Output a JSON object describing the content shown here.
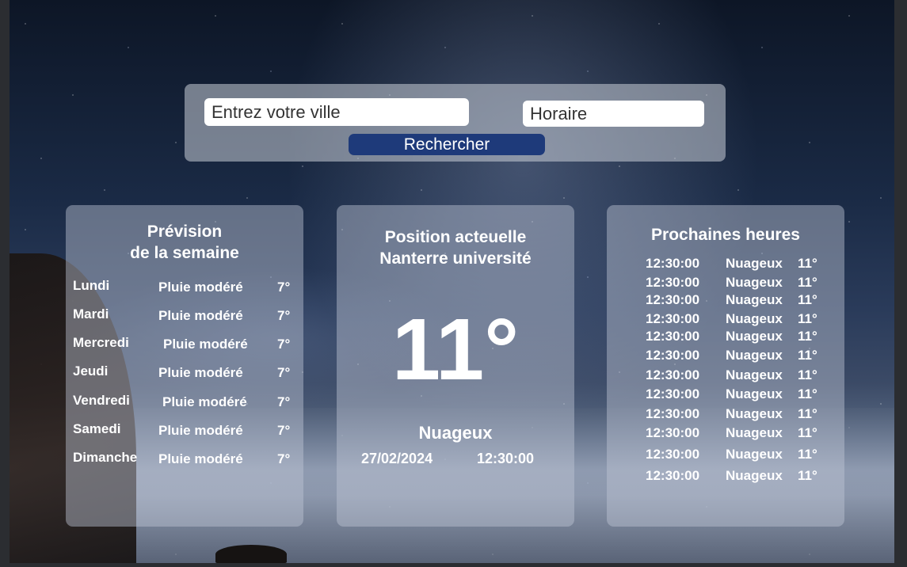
{
  "search": {
    "city_placeholder": "Entrez votre ville",
    "time_placeholder": "Horaire",
    "button_label": "Rechercher"
  },
  "week": {
    "title_line1": "Prévision",
    "title_line2": "de la semaine",
    "days": [
      {
        "day": "Lundi",
        "condition": "Pluie modéré",
        "temp": "7°"
      },
      {
        "day": "Mardi",
        "condition": "Pluie modéré",
        "temp": "7°"
      },
      {
        "day": "Mercredi",
        "condition": "Pluie modéré",
        "temp": "7°"
      },
      {
        "day": "Jeudi",
        "condition": "Pluie modéré",
        "temp": "7°"
      },
      {
        "day": "Vendredi",
        "condition": "Pluie modéré",
        "temp": "7°"
      },
      {
        "day": "Samedi",
        "condition": "Pluie modéré",
        "temp": "7°"
      },
      {
        "day": "Dimanche",
        "condition": "Pluie modéré",
        "temp": "7°"
      }
    ]
  },
  "current": {
    "title_line1": "Position acteuelle",
    "title_line2": "Nanterre université",
    "temperature": "11°",
    "condition": "Nuageux",
    "date": "27/02/2024",
    "time": "12:30:00"
  },
  "hours": {
    "title": "Prochaines heures",
    "items": [
      {
        "time": "12:30:00",
        "condition": "Nuageux",
        "temp": "11°"
      },
      {
        "time": "12:30:00",
        "condition": "Nuageux",
        "temp": "11°"
      },
      {
        "time": "12:30:00",
        "condition": "Nuageux",
        "temp": "11°"
      },
      {
        "time": "12:30:00",
        "condition": "Nuageux",
        "temp": "11°"
      },
      {
        "time": "12:30:00",
        "condition": "Nuageux",
        "temp": "11°"
      },
      {
        "time": "12:30:00",
        "condition": "Nuageux",
        "temp": "11°"
      },
      {
        "time": "12:30:00",
        "condition": "Nuageux",
        "temp": "11°"
      },
      {
        "time": "12:30:00",
        "condition": "Nuageux",
        "temp": "11°"
      },
      {
        "time": "12:30:00",
        "condition": "Nuageux",
        "temp": "11°"
      },
      {
        "time": "12:30:00",
        "condition": "Nuageux",
        "temp": "11°"
      },
      {
        "time": "12:30:00",
        "condition": "Nuageux",
        "temp": "11°"
      },
      {
        "time": "12:30:00",
        "condition": "Nuageux",
        "temp": "11°"
      }
    ]
  },
  "colors": {
    "button": "#1e3a7a",
    "panel": "#c8cdd7",
    "text": "#ffffff"
  }
}
